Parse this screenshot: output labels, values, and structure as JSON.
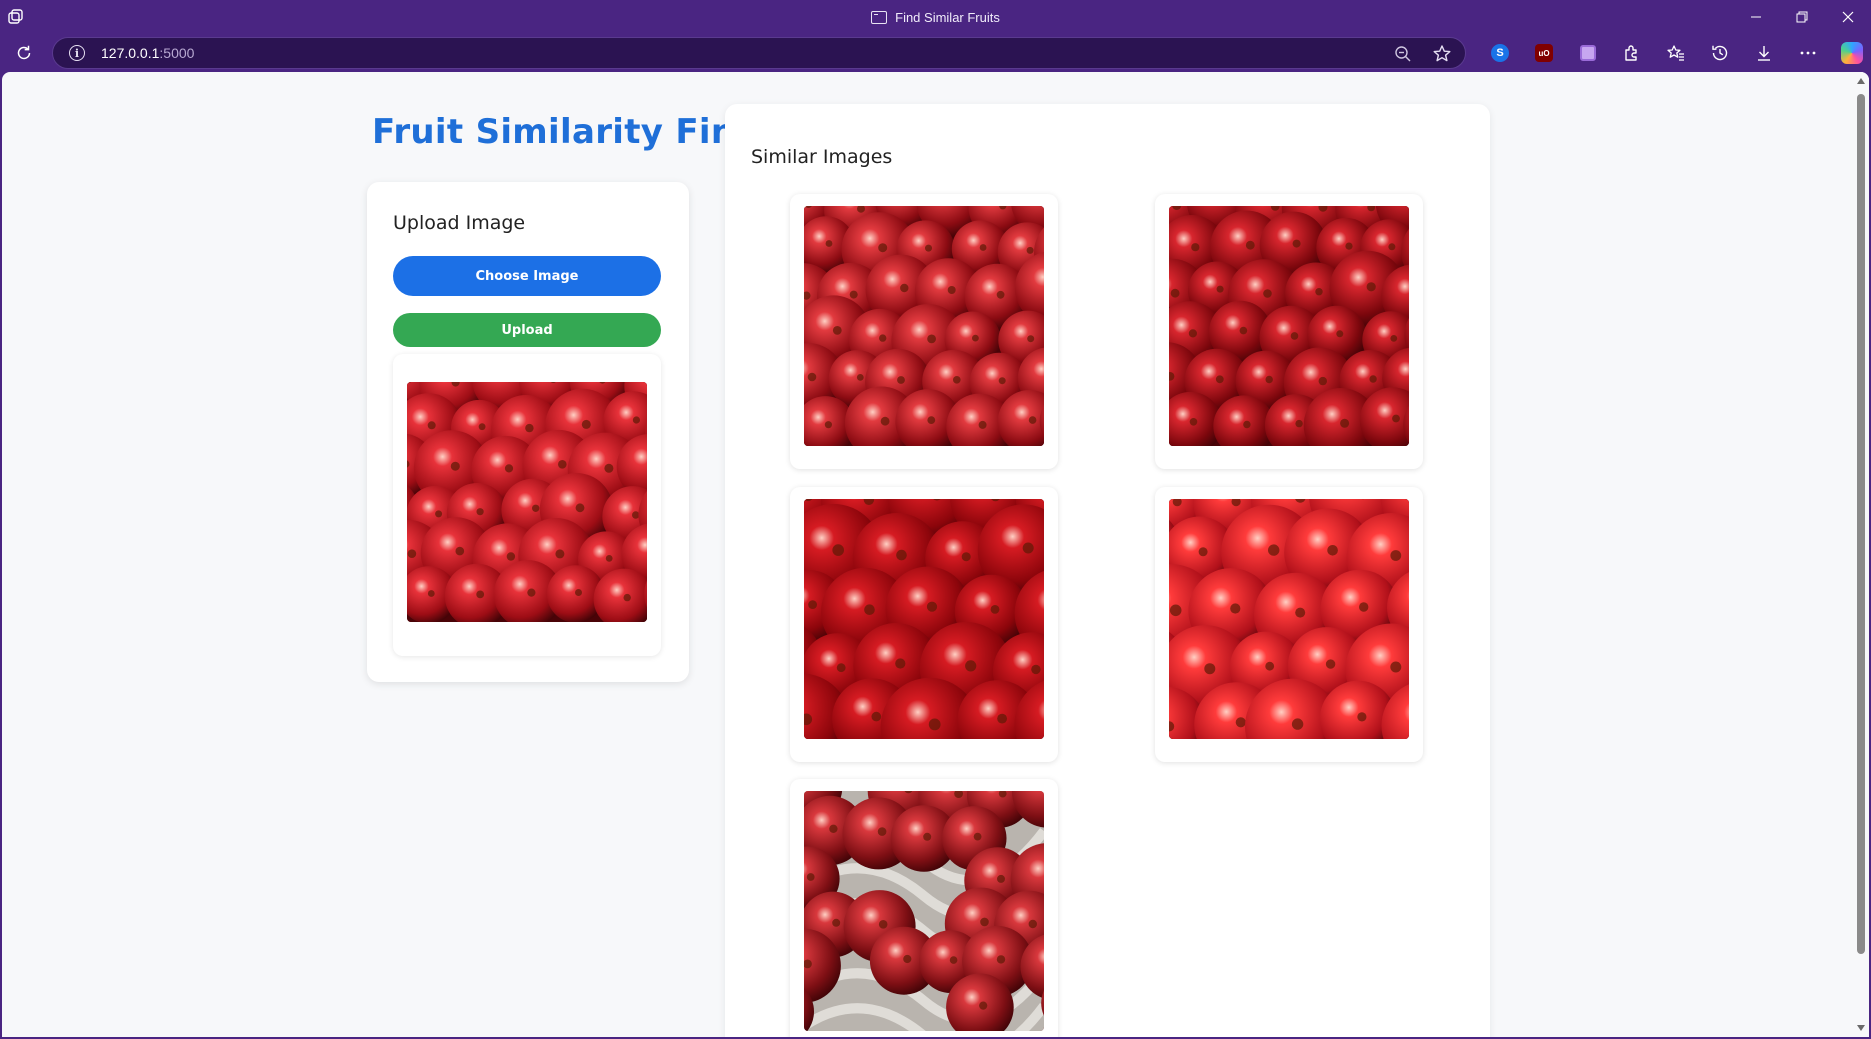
{
  "browser": {
    "window_title": "Find Similar Fruits",
    "url_host": "127.0.0.1",
    "url_port": ":5000",
    "icons": [
      "workspaces-icon",
      "reload-icon",
      "info-icon",
      "zoom-out-icon",
      "favorite-star-icon",
      "extension-shazam-icon",
      "extension-ublock-icon",
      "extension-purple-icon",
      "extensions-icon",
      "favorites-icon",
      "history-icon",
      "downloads-icon",
      "more-icon",
      "copilot-icon"
    ],
    "ublock_label": "uO"
  },
  "page": {
    "title": "Fruit Similarity Finder",
    "upload": {
      "heading": "Upload Image",
      "choose_button": "Choose Image",
      "upload_button": "Upload"
    },
    "results": {
      "heading": "Similar Images",
      "count": 5
    }
  },
  "colors": {
    "accent_blue": "#1c70e6",
    "upload_green": "#34a853",
    "title_blue": "#1f6fd8",
    "browser_purple": "#4a2582"
  }
}
